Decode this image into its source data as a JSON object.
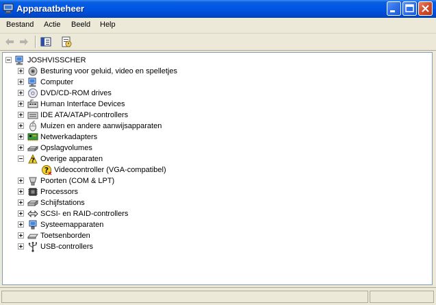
{
  "window": {
    "title": "Apparaatbeheer",
    "icon": "device-manager-icon"
  },
  "title_buttons": [
    "minimize-icon",
    "maximize-icon",
    "close-icon"
  ],
  "menu": [
    {
      "label": "Bestand"
    },
    {
      "label": "Actie"
    },
    {
      "label": "Beeld"
    },
    {
      "label": "Help"
    }
  ],
  "toolbar": [
    "back-arrow-icon",
    "forward-arrow-icon",
    "show-hide-console-tree-icon",
    "properties-icon"
  ],
  "tree": {
    "root": {
      "label": "JOSHVISSCHER",
      "icon": "computer-icon",
      "expanded": true
    },
    "items": [
      {
        "label": "Besturing voor geluid, video en spelletjes",
        "icon": "sound-icon",
        "expanded": false
      },
      {
        "label": "Computer",
        "icon": "computer-icon",
        "expanded": false
      },
      {
        "label": "DVD/CD-ROM drives",
        "icon": "cdrom-icon",
        "expanded": false
      },
      {
        "label": "Human Interface Devices",
        "icon": "hid-icon",
        "expanded": false
      },
      {
        "label": "IDE ATA/ATAPI-controllers",
        "icon": "ide-controller-icon",
        "expanded": false
      },
      {
        "label": "Muizen en andere aanwijsapparaten",
        "icon": "mouse-icon",
        "expanded": false
      },
      {
        "label": "Netwerkadapters",
        "icon": "network-adapter-icon",
        "expanded": false
      },
      {
        "label": "Opslagvolumes",
        "icon": "storage-volume-icon",
        "expanded": false
      },
      {
        "label": "Overige apparaten",
        "icon": "unknown-device-icon",
        "expanded": true,
        "children": [
          {
            "label": "Videocontroller (VGA-compatibel)",
            "icon": "warning-device-icon"
          }
        ]
      },
      {
        "label": "Poorten (COM & LPT)",
        "icon": "port-icon",
        "expanded": false
      },
      {
        "label": "Processors",
        "icon": "processor-icon",
        "expanded": false
      },
      {
        "label": "Schijfstations",
        "icon": "disk-drive-icon",
        "expanded": false
      },
      {
        "label": "SCSI- en RAID-controllers",
        "icon": "scsi-icon",
        "expanded": false
      },
      {
        "label": "Systeemapparaten",
        "icon": "system-device-icon",
        "expanded": false
      },
      {
        "label": "Toetsenborden",
        "icon": "keyboard-icon",
        "expanded": false
      },
      {
        "label": "USB-controllers",
        "icon": "usb-icon",
        "expanded": false
      }
    ]
  }
}
